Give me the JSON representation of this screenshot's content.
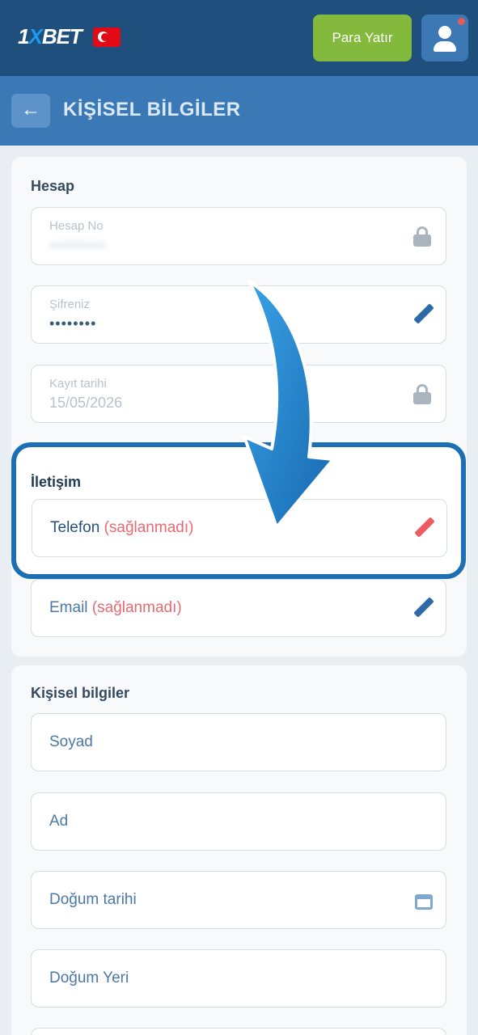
{
  "header": {
    "logo_text_a": "1",
    "logo_text_x": "X",
    "logo_text_b": "BET",
    "deposit_label": "Para Yatır"
  },
  "subheader": {
    "back_glyph": "←",
    "title": "KİŞİSEL BİLGİLER"
  },
  "account": {
    "section_title": "Hesap",
    "account_no_label": "Hesap No",
    "account_no_value": "•••••••••••",
    "password_label": "Şifreniz",
    "password_value": "••••••••",
    "reg_date_label": "Kayıt tarihi",
    "reg_date_value": "15/05/2026"
  },
  "contact": {
    "section_title": "İletişim",
    "phone_label": "Telefon",
    "phone_status": "(sağlanmadı)",
    "email_label": "Email",
    "email_status": "(sağlanmadı)"
  },
  "personal": {
    "section_title": "Kişisel bilgiler",
    "surname_placeholder": "Soyad",
    "name_placeholder": "Ad",
    "birthdate_placeholder": "Doğum tarihi",
    "birthplace_placeholder": "Doğum Yeri"
  },
  "icons": {
    "flag": "turkey-flag-icon",
    "user": "user-icon",
    "lock": "lock-icon",
    "edit": "pencil-icon",
    "calendar": "calendar-icon",
    "pointer": "arrow-down-icon"
  },
  "colors": {
    "header_bg": "#1e4f7d",
    "subheader_bg": "#3a78b6",
    "deposit_green": "#83b93c",
    "highlight_border": "#1c6fb3",
    "warning_red": "#e66a72"
  }
}
